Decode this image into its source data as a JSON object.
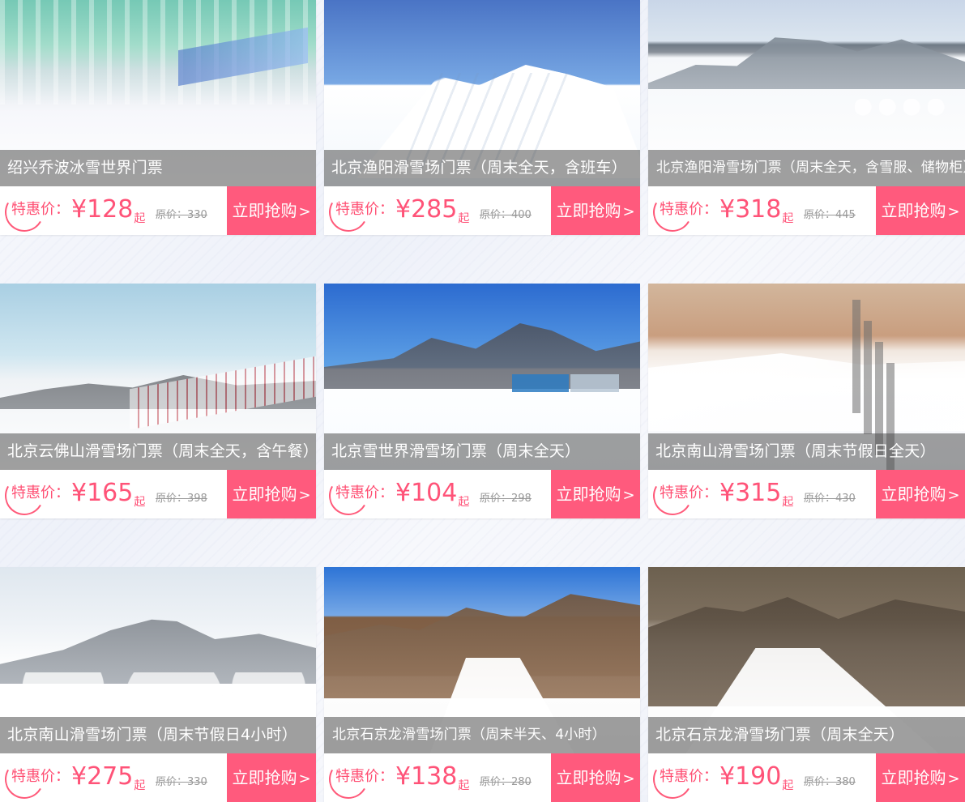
{
  "cards": [
    {
      "title": "绍兴乔波冰雪世界门票",
      "label": "特惠价：",
      "price": "¥128",
      "suffix": "起",
      "orig_label": "原价：",
      "orig": "330",
      "buy": "立即抢购",
      "arrow": ">"
    },
    {
      "title": "北京渔阳滑雪场门票（周末全天，含班车）",
      "label": "特惠价：",
      "price": "¥285",
      "suffix": "起",
      "orig_label": "原价：",
      "orig": "400",
      "buy": "立即抢购",
      "arrow": ">"
    },
    {
      "title": "北京渔阳滑雪场门票（周末全天，含雪服、储物柜）",
      "label": "特惠价：",
      "price": "¥318",
      "suffix": "起",
      "orig_label": "原价：",
      "orig": "445",
      "buy": "立即抢购",
      "arrow": ">"
    },
    {
      "title": "北京云佛山滑雪场门票（周末全天，含午餐）",
      "label": "特惠价：",
      "price": "¥165",
      "suffix": "起",
      "orig_label": "原价：",
      "orig": "398",
      "buy": "立即抢购",
      "arrow": ">"
    },
    {
      "title": "北京雪世界滑雪场门票（周末全天）",
      "label": "特惠价：",
      "price": "¥104",
      "suffix": "起",
      "orig_label": "原价：",
      "orig": "298",
      "buy": "立即抢购",
      "arrow": ">"
    },
    {
      "title": "北京南山滑雪场门票（周末节假日全天）",
      "label": "特惠价：",
      "price": "¥315",
      "suffix": "起",
      "orig_label": "原价：",
      "orig": "430",
      "buy": "立即抢购",
      "arrow": ">"
    },
    {
      "title": "北京南山滑雪场门票（周末节假日4小时）",
      "label": "特惠价：",
      "price": "¥275",
      "suffix": "起",
      "orig_label": "原价：",
      "orig": "330",
      "buy": "立即抢购",
      "arrow": ">"
    },
    {
      "title": "北京石京龙滑雪场门票（周末半天、4小时）",
      "label": "特惠价：",
      "price": "¥138",
      "suffix": "起",
      "orig_label": "原价：",
      "orig": "280",
      "buy": "立即抢购",
      "arrow": ">"
    },
    {
      "title": "北京石京龙滑雪场门票（周末全天）",
      "label": "特惠价：",
      "price": "¥190",
      "suffix": "起",
      "orig_label": "原价：",
      "orig": "380",
      "buy": "立即抢购",
      "arrow": ">"
    }
  ],
  "colors": {
    "accent": "#ff5a7d",
    "price": "#ff5378",
    "text_muted": "#999999"
  }
}
